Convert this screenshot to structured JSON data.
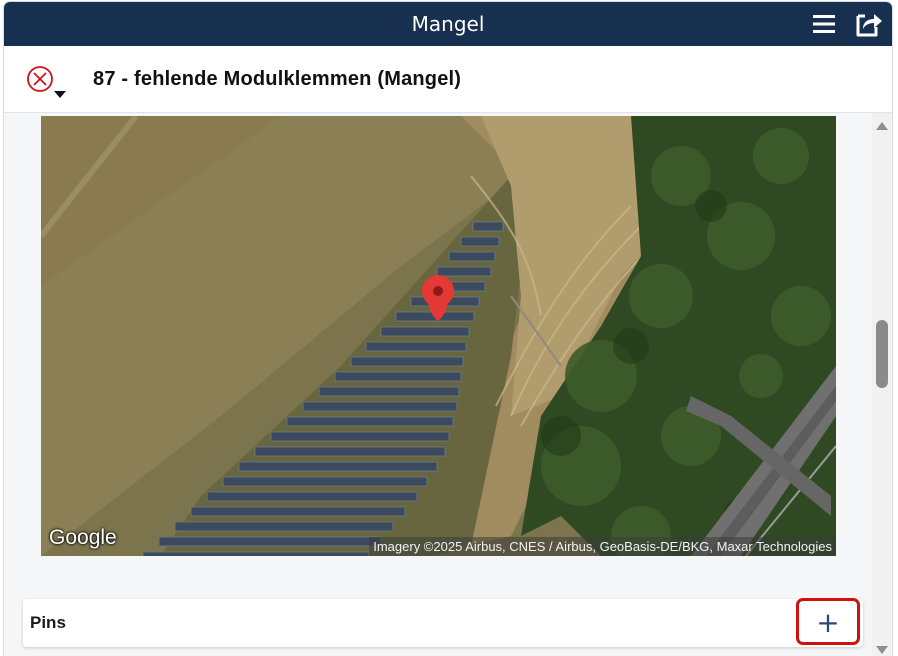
{
  "window": {
    "title": "Mangel",
    "menu_icon": "hamburger-menu-icon",
    "export_icon": "share-export-icon"
  },
  "header": {
    "status_icon": "circle-x-status-icon",
    "dropdown_icon": "caret-down-icon",
    "item_title": "87 - fehlende Modulklemmen (Mangel)"
  },
  "map": {
    "logo_text": "Google",
    "attribution": "Imagery ©2025 Airbus, CNES / Airbus, GeoBasis-DE/BKG, Maxar Technologies",
    "marker_icon": "map-pin-icon",
    "marker_color": "#e53935"
  },
  "pins": {
    "label": "Pins",
    "add_label": "+"
  },
  "colors": {
    "titlebar_bg": "#17304f",
    "status_red": "#d0101a",
    "highlight_border": "#d01111",
    "plus_color": "#2d4a73"
  }
}
